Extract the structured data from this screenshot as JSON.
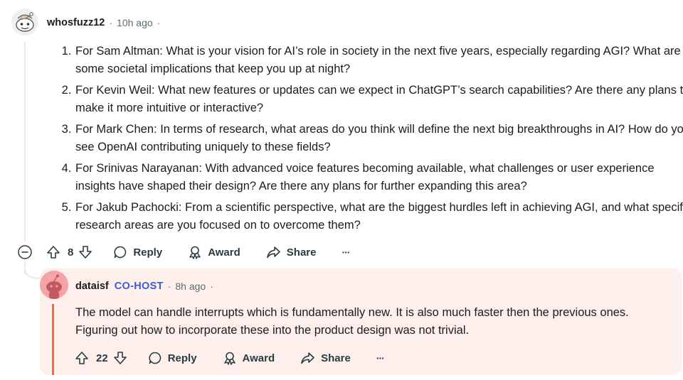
{
  "comment": {
    "username": "whosfuzz12",
    "time_ago": "10h ago",
    "questions": [
      "For Sam Altman: What is your vision for AI’s role in society in the next five years, especially regarding AGI? What are some societal implications that keep you up at night?",
      "For Kevin Weil: What new features or updates can we expect in ChatGPT’s search capabilities? Are there any plans to make it more intuitive or interactive?",
      "For Mark Chen: In terms of research, what areas do you think will define the next big breakthroughs in AI? How do you see OpenAI contributing uniquely to these fields?",
      "For Srinivas Narayanan: With advanced voice features becoming available, what challenges or user experience insights have shaped their design? Are there any plans for further expanding this area?",
      "For Jakub Pachocki: From a scientific perspective, what are the biggest hurdles left in achieving AGI, and what specific research areas are you focused on to overcome them?"
    ],
    "votes": "8",
    "reply_label": "Reply",
    "award_label": "Award",
    "share_label": "Share",
    "more_label": "···"
  },
  "reply": {
    "username": "dataisf",
    "badge": "CO-HOST",
    "time_ago": "8h ago",
    "text": "The model can handle interrupts which is fundamentally new. It is also much faster then the previous ones. Figuring out how to incorporate these into the product design was not trivial.",
    "votes": "22",
    "reply_label": "Reply",
    "award_label": "Award",
    "share_label": "Share",
    "more_label": "···"
  },
  "colors": {
    "accent": "#f26b3a",
    "cohost": "#3a5bd9",
    "reply_bg": "#fdf0ec"
  },
  "icons": [
    "collapse-icon",
    "upvote-icon",
    "downvote-icon",
    "reply-icon",
    "award-icon",
    "share-icon",
    "more-icon"
  ]
}
